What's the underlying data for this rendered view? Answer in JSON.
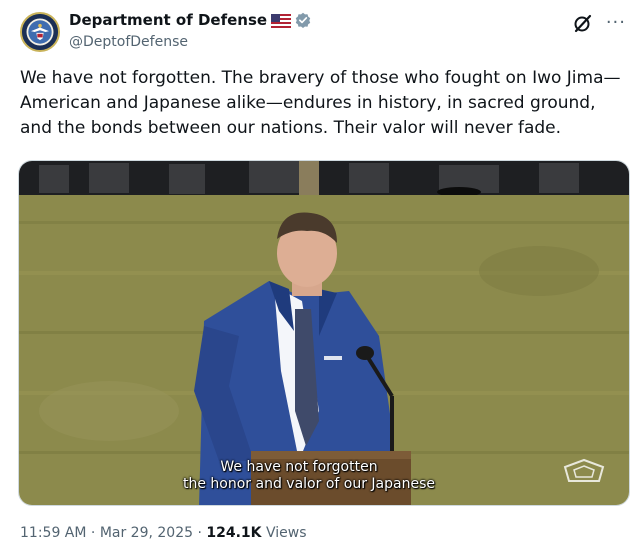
{
  "author": {
    "display_name": "Department of Defense",
    "handle": "@DeptofDefense",
    "flag_icon": "us-flag-icon",
    "verified_icon": "verified-badge-icon",
    "badge_color": "#829aab"
  },
  "tweet": {
    "text": "We have not forgotten. The bravery of those who fought on Iwo Jima—American and Japanese alike—endures in history, in sacred ground, and the bonds between our nations. Their valor will never fade."
  },
  "media": {
    "subtitle_line1": "We have not forgotten",
    "subtitle_line2": "the honor and valor of our Japanese"
  },
  "footer": {
    "time": "11:59 AM",
    "sep1": " · ",
    "date": "Mar 29, 2025",
    "sep2": " · ",
    "views_count": "124.1K",
    "views_label": " Views"
  },
  "actions": {
    "grok_icon": "grok-icon",
    "more_icon": "more-icon"
  }
}
